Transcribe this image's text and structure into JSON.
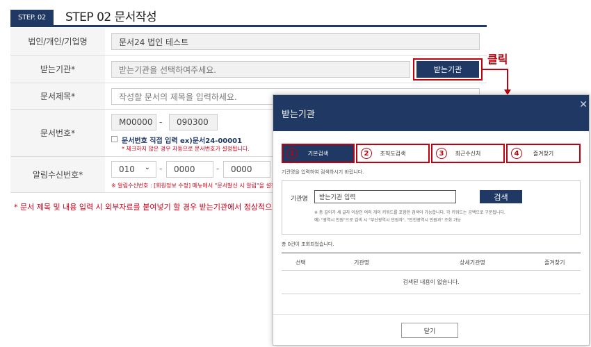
{
  "step": {
    "badge": "STEP. 02",
    "title": "STEP 02 문서작성"
  },
  "form": {
    "org": {
      "label": "법인/개인/기업명",
      "value": "문서24 법인 테스트"
    },
    "recipient": {
      "label": "받는기관*",
      "placeholder": "받는기관을 선택하여주세요.",
      "button": "받는기관"
    },
    "subject": {
      "label": "문서제목*",
      "placeholder": "작성할 문서의 제목을 입력하세요."
    },
    "doc_number": {
      "label": "문서번호*",
      "prefix": "M00000",
      "separator": "-",
      "suffix": "090300",
      "checkbox_label": "문서번호 직접 입력 ex)문서24-00001",
      "note": "* 체크하지 않은 경우 자동으로 문서번호가 설정됩니다."
    },
    "phone": {
      "label": "알림수신번호*",
      "area": "010",
      "dropdown_icon": "chevron-down-icon",
      "sep1": "-",
      "mid": "0000",
      "sep2": "-",
      "last": "0000",
      "note": "※ 알림수신번호 : [회원정보 수정] 메뉴에서 \"문서발신 시 알림\"을 설정한 경"
    },
    "notice": "* 문서 제목 및 내용 입력 시 외부자료를 붙여넣기 할 경우 받는기관에서 정상적으로 보이"
  },
  "annotation": {
    "click_text": "클릭"
  },
  "modal": {
    "title": "받는기관",
    "close_icon": "close-icon",
    "tabs": [
      {
        "num": "1",
        "label": "기본검색"
      },
      {
        "num": "2",
        "label": "조직도검색"
      },
      {
        "num": "3",
        "label": "최근수신처"
      },
      {
        "num": "4",
        "label": "즐겨찾기"
      }
    ],
    "guide": "기관명을 입력하여 검색하시기 바랍니다.",
    "search": {
      "label": "기관명",
      "placeholder": "받는기관 입력",
      "button": "검색",
      "note1": "※ 총 길이가 세 글자 이상인 여러 개의 키워드를 포함한 검색이 가능합니다. 각 키워드는 공백으로 구분됩니다.",
      "note2": "예) \"광역시 민원\"으로 검색 시 \"부산광역시 민원과\", \"인천광역시 민원과\" 조회 가능"
    },
    "count": "총 0건이 조회되었습니다.",
    "columns": [
      "선택",
      "기관명",
      "상세기관명",
      "즐겨찾기"
    ],
    "empty": "검색된 내용이 없습니다.",
    "close_button": "닫기"
  },
  "colors": {
    "navy": "#1f3864",
    "annotation_red": "#c0000c",
    "notice_red": "#d0021b"
  }
}
